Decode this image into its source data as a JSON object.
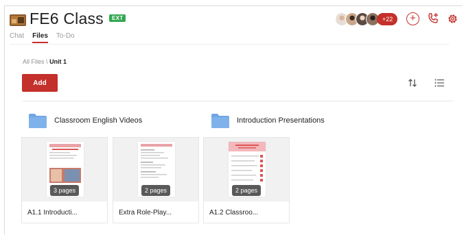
{
  "header": {
    "class_name": "FE6 Class",
    "ext_badge": "EXT",
    "member_count": "+22",
    "tabs": [
      {
        "label": "Chat",
        "active": false
      },
      {
        "label": "Files",
        "active": true
      },
      {
        "label": "To-Do",
        "active": false
      }
    ]
  },
  "breadcrumb": {
    "root": "All Files",
    "separator": "\\",
    "current": "Unit 1"
  },
  "toolbar": {
    "add_label": "Add"
  },
  "folders": [
    {
      "name": "Classroom English Videos",
      "icon": "folder-icon"
    },
    {
      "name": "Introduction Presentations",
      "icon": "folder-icon"
    }
  ],
  "files": [
    {
      "name": "A1.1 Introducti...",
      "pages": "3 pages"
    },
    {
      "name": "Extra Role-Play...",
      "pages": "2 pages"
    },
    {
      "name": "A1.2 Classroo...",
      "pages": "2 pages"
    }
  ],
  "colors": {
    "accent": "#c4302b",
    "ext_badge": "#33a852",
    "folder": "#6fa6e4"
  }
}
